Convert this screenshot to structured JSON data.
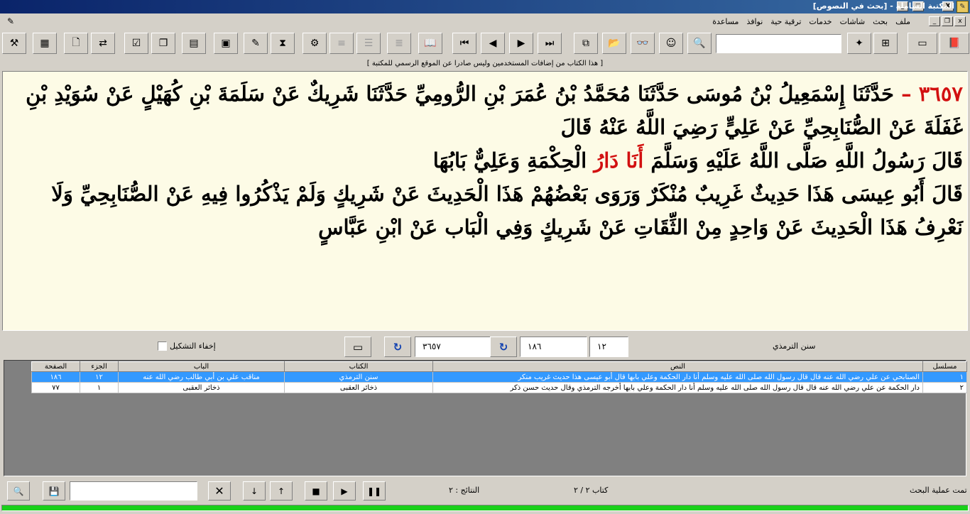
{
  "window": {
    "title": "المكتبة الشاملة - [بحث في النصوص]",
    "minimize": "_",
    "maximize": "□",
    "close": "X"
  },
  "menu": {
    "items": [
      "ملف",
      "بحث",
      "شاشات",
      "خدمات",
      "ترقية حية",
      "نوافذ",
      "مساعدة"
    ]
  },
  "toolbar": {
    "buttons": [
      {
        "icon": "tools-icon",
        "glyph": "⚒"
      },
      {
        "icon": "calendar-icon",
        "glyph": "▦"
      },
      {
        "icon": "new-doc-icon",
        "glyph": "🗋"
      },
      {
        "icon": "compare-icon",
        "glyph": "⇄"
      },
      {
        "icon": "checklist-icon",
        "glyph": "☑"
      },
      {
        "icon": "copy-icon",
        "glyph": "❐"
      },
      {
        "icon": "document-icon",
        "glyph": "▤"
      },
      {
        "icon": "image-icon",
        "glyph": "▣"
      },
      {
        "icon": "pencil-icon",
        "glyph": "✎"
      },
      {
        "icon": "filter-icon",
        "glyph": "⧗"
      },
      {
        "icon": "settings-icon",
        "glyph": "⚙"
      },
      {
        "icon": "align-icon",
        "glyph": "≡"
      },
      {
        "icon": "list-icon",
        "glyph": "☰"
      },
      {
        "icon": "lines-icon",
        "glyph": "≣"
      },
      {
        "icon": "open-book-icon",
        "glyph": "📖"
      },
      {
        "icon": "first-page-icon",
        "glyph": "⏮"
      },
      {
        "icon": "prev-page-icon",
        "glyph": "◀"
      },
      {
        "icon": "next-page-icon",
        "glyph": "▶"
      },
      {
        "icon": "last-page-icon",
        "glyph": "⏭"
      },
      {
        "icon": "windows-icon",
        "glyph": "⧉"
      },
      {
        "icon": "folder-open-icon",
        "glyph": "📂"
      },
      {
        "icon": "binoculars-icon",
        "glyph": "👓"
      },
      {
        "icon": "head-icon",
        "glyph": "☺"
      },
      {
        "icon": "search-page-icon",
        "glyph": "🔍"
      },
      {
        "icon": "new-star-icon",
        "glyph": "✦"
      },
      {
        "icon": "tree-icon",
        "glyph": "⊞"
      },
      {
        "icon": "book-closed-icon",
        "glyph": "▭"
      },
      {
        "icon": "book-gold-icon",
        "glyph": "📕"
      }
    ],
    "search_value": ""
  },
  "notice": "[ هذا الكتاب من إضافات المستخدمين وليس صادرا عن الموقع الرسمي للمكتبة ]",
  "hadith": {
    "number": "٣٦٥٧",
    "dash": "–",
    "isnad": "حَدَّثَنَا إِسْمَعِيلُ بْنُ مُوسَى حَدَّثَنَا مُحَمَّدُ بْنُ عُمَرَ بْنِ الرُّومِيِّ حَدَّثَنَا شَرِيكٌ عَنْ سَلَمَةَ بْنِ كُهَيْلٍ عَنْ سُوَيْدِ بْنِ غَفَلَةَ عَنْ الصُّنَابِحِيِّ عَنْ عَلِيٍّ رَضِيَ اللَّهُ عَنْهُ قَالَ",
    "matn_before": "قَالَ رَسُولُ اللَّهِ صَلَّى اللَّهُ عَلَيْهِ وَسَلَّمَ",
    "matn_highlight": "أَنَا دَارُ",
    "matn_after": "الْحِكْمَةِ وَعَلِيٌّ بَابُهَا",
    "comment": "قَالَ أَبُو عِيسَى هَذَا حَدِيثٌ غَرِيبٌ مُنْكَرٌ وَرَوَى بَعْضُهُمْ هَذَا الْحَدِيثَ عَنْ شَرِيكٍ وَلَمْ يَذْكُرُوا فِيهِ عَنْ الصُّنَابِحِيِّ وَلَا نَعْرِفُ هَذَا الْحَدِيثَ عَنْ وَاحِدٍ مِنْ الثِّقَاتِ عَنْ شَرِيكٍ وَفِي الْبَاب عَنْ ابْنِ عَبَّاسٍ"
  },
  "controls": {
    "book_name": "سنن الترمذي",
    "part": "١٢",
    "page": "١٨٦",
    "hadith_no": "٣٦٥٧",
    "hide_tashkeel_label": "إخفاء التشكيل",
    "hide_tashkeel_checked": false
  },
  "results": {
    "columns": [
      "مسلسل",
      "النص",
      "الكتاب",
      "الباب",
      "الجزء",
      "الصفحة"
    ],
    "rows": [
      {
        "serial": "١",
        "text": "الصنابحي عن علي رضي الله عنه قال قال رسول الله صلى الله عليه وسلم أنا دار الحكمة وعلي بابها قال أبو عيسى هذا حديث غريب منكر",
        "book": "سنن الترمذي",
        "chapter": "مناقب علي بن أبي طالب رضي الله عنه",
        "part": "١٢",
        "page": "١٨٦",
        "selected": true
      },
      {
        "serial": "٢",
        "text": "دار الحكمة عن علي رضي الله عنه قال قال رسول الله صلى الله عليه وسلم أنا دار الحكمة وعلي بابها أخرجه الترمذي وقال حديث حسن ذكر",
        "book": "ذخائر العقبى",
        "chapter": "ذخائر العقبى",
        "part": "١",
        "page": "٧٧",
        "selected": false
      }
    ]
  },
  "status": {
    "search_done": "تمت عملية البحث",
    "book_count": "كتاب ٢ / ٢",
    "results_count": "النتائج : ٢",
    "progress": 1.0
  }
}
